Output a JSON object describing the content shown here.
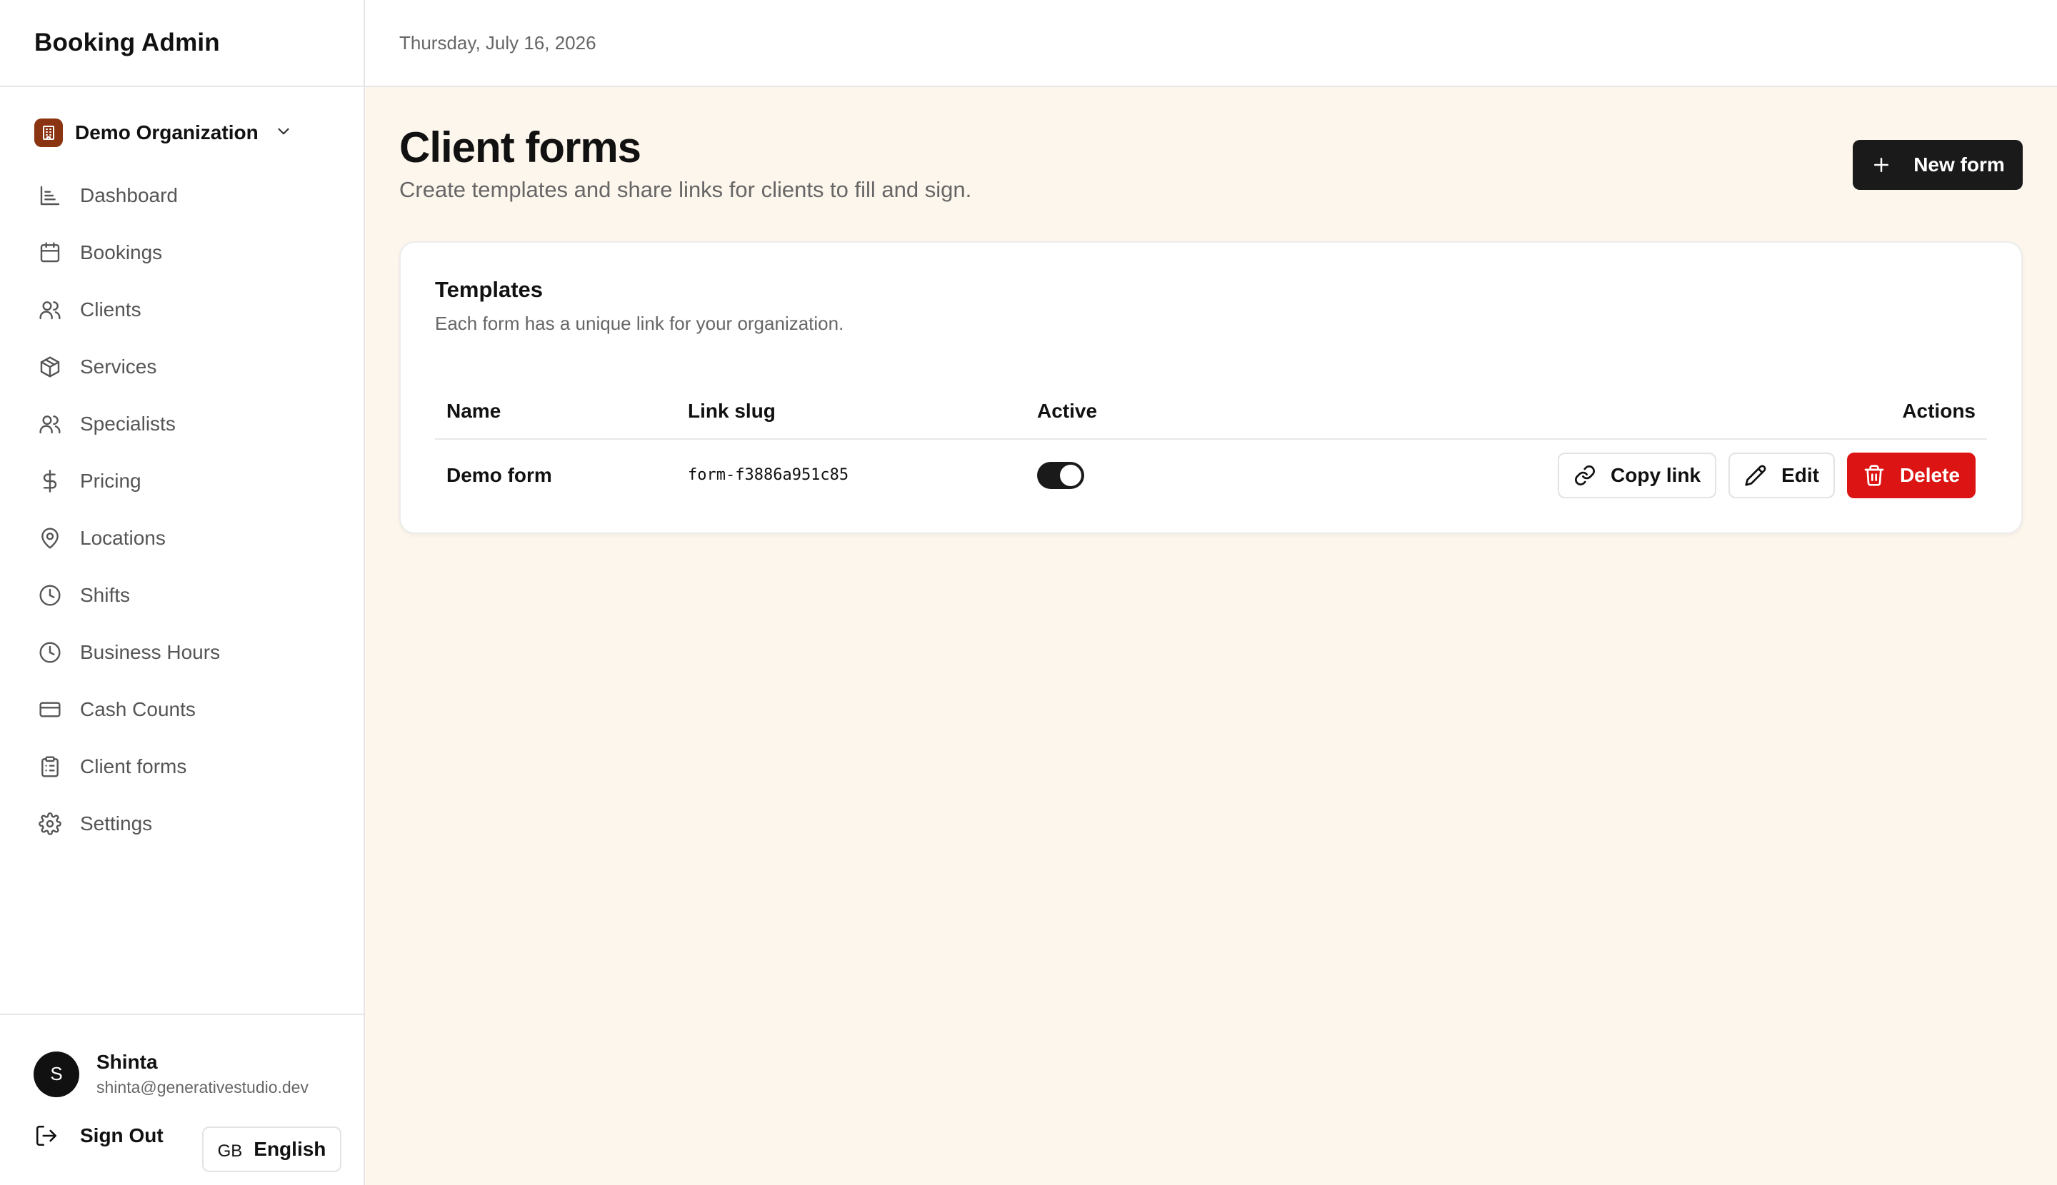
{
  "app": {
    "title": "Booking Admin"
  },
  "header": {
    "date": "Thursday, July 16, 2026"
  },
  "org": {
    "name": "Demo Organization"
  },
  "sidebar": {
    "items": [
      {
        "label": "Dashboard",
        "icon": "chart-icon"
      },
      {
        "label": "Bookings",
        "icon": "calendar-icon"
      },
      {
        "label": "Clients",
        "icon": "users-icon"
      },
      {
        "label": "Services",
        "icon": "box-icon"
      },
      {
        "label": "Specialists",
        "icon": "users-icon"
      },
      {
        "label": "Pricing",
        "icon": "dollar-icon"
      },
      {
        "label": "Locations",
        "icon": "map-pin-icon"
      },
      {
        "label": "Shifts",
        "icon": "clock-icon"
      },
      {
        "label": "Business Hours",
        "icon": "clock-icon"
      },
      {
        "label": "Cash Counts",
        "icon": "credit-card-icon"
      },
      {
        "label": "Client forms",
        "icon": "clipboard-icon"
      },
      {
        "label": "Settings",
        "icon": "gear-icon"
      }
    ],
    "active": "Client forms"
  },
  "user": {
    "initial": "S",
    "name": "Shinta",
    "email": "shinta@generativestudio.dev",
    "sign_out_label": "Sign Out"
  },
  "language": {
    "flag": "GB",
    "label": "English"
  },
  "page": {
    "title": "Client forms",
    "subtitle": "Create templates and share links for clients to fill and sign.",
    "new_button_label": "New form"
  },
  "templates": {
    "title": "Templates",
    "description": "Each form has a unique link for your organization.",
    "columns": [
      "Name",
      "Link slug",
      "Active",
      "Actions"
    ],
    "rows": [
      {
        "name": "Demo form",
        "slug": "form-f3886a951c85",
        "active": true
      }
    ],
    "actions": {
      "copy": "Copy link",
      "edit": "Edit",
      "delete": "Delete"
    }
  },
  "colors": {
    "background": "#fdf6ec",
    "primary": "#1a1a1a",
    "danger": "#dc1414",
    "org_badge": "#8a3412"
  }
}
